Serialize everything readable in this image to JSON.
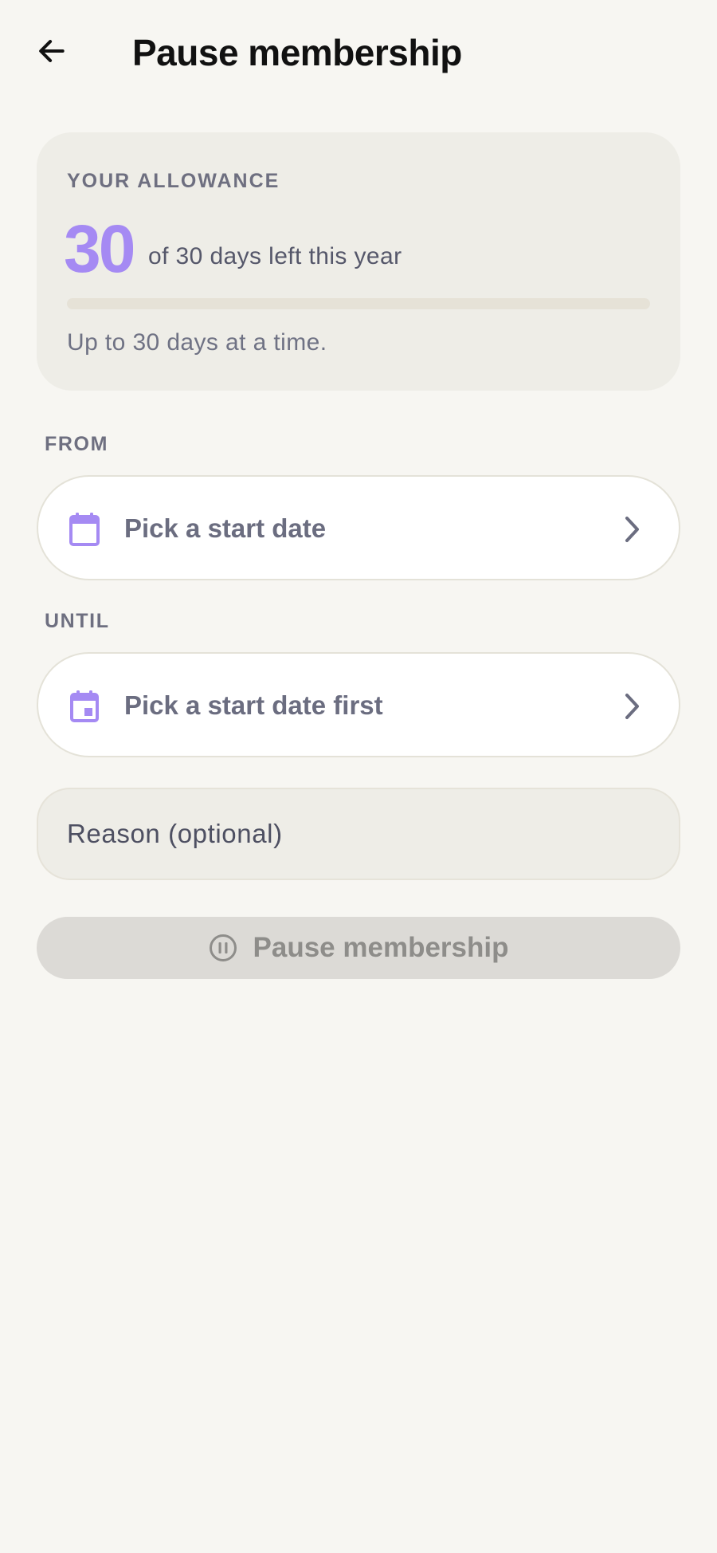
{
  "header": {
    "title": "Pause membership",
    "back_icon": "arrow-left-icon"
  },
  "allowance": {
    "label": "YOUR ALLOWANCE",
    "days_left": "30",
    "days_left_text": "of 30 days left this year",
    "days_used_fraction": 0,
    "hint": "Up to 30 days at a time.",
    "accent_color": "#a58af3"
  },
  "from": {
    "label": "FROM",
    "placeholder": "Pick a start date",
    "icon": "calendar-icon"
  },
  "until": {
    "label": "UNTIL",
    "placeholder": "Pick a start date first",
    "icon": "calendar-event-icon"
  },
  "reason": {
    "placeholder": "Reason (optional)",
    "value": ""
  },
  "submit": {
    "label": "Pause membership",
    "icon": "pause-circle-icon",
    "enabled": false
  }
}
